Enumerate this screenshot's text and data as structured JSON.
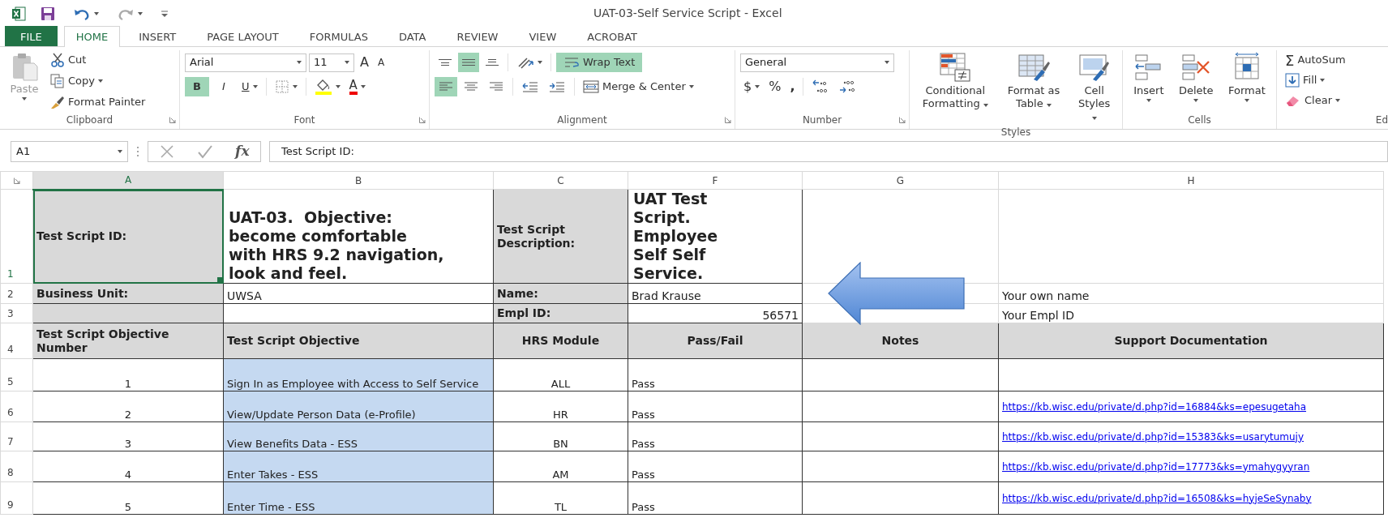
{
  "window": {
    "title": "UAT-03-Self Service Script - Excel"
  },
  "tabs": [
    {
      "label": "FILE",
      "kind": "file",
      "selected": false
    },
    {
      "label": "HOME",
      "kind": "tab",
      "selected": true
    },
    {
      "label": "INSERT",
      "kind": "tab",
      "selected": false
    },
    {
      "label": "PAGE LAYOUT",
      "kind": "tab",
      "selected": false
    },
    {
      "label": "FORMULAS",
      "kind": "tab",
      "selected": false
    },
    {
      "label": "DATA",
      "kind": "tab",
      "selected": false
    },
    {
      "label": "REVIEW",
      "kind": "tab",
      "selected": false
    },
    {
      "label": "VIEW",
      "kind": "tab",
      "selected": false
    },
    {
      "label": "ACROBAT",
      "kind": "tab",
      "selected": false
    }
  ],
  "ribbon": {
    "clipboard": {
      "label": "Clipboard",
      "paste": {
        "label": "Paste",
        "disabled": true
      },
      "cut": "Cut",
      "copy": "Copy",
      "format_painter": "Format Painter"
    },
    "font": {
      "label": "Font",
      "font_name": "Arial",
      "font_size": "11",
      "grow": "A",
      "shrink": "A",
      "bold": {
        "label": "B",
        "on": true
      },
      "italic": {
        "label": "I",
        "on": false
      },
      "underline": {
        "label": "U",
        "on": false
      },
      "font_color": "A"
    },
    "alignment": {
      "label": "Alignment",
      "vertical": [
        {
          "kind": "top",
          "selected": false
        },
        {
          "kind": "middle",
          "selected": true
        },
        {
          "kind": "bottom",
          "selected": false
        }
      ],
      "horizontal": [
        {
          "kind": "left",
          "selected": true
        },
        {
          "kind": "center",
          "selected": false
        },
        {
          "kind": "right",
          "selected": false
        }
      ],
      "wrap_text": {
        "label": "Wrap Text",
        "on": true
      },
      "merge": "Merge & Center"
    },
    "number": {
      "label": "Number",
      "format": "General",
      "currency": "$",
      "percent": "%",
      "comma": ","
    },
    "styles": {
      "label": "Styles",
      "buttons": [
        {
          "kind": "conditional",
          "label": "Conditional Formatting"
        },
        {
          "kind": "table",
          "label": "Format as Table"
        },
        {
          "kind": "cellstyles",
          "label": "Cell Styles"
        }
      ]
    },
    "cells": {
      "label": "Cells",
      "buttons": [
        {
          "kind": "insert",
          "label": "Insert"
        },
        {
          "kind": "delete",
          "label": "Delete"
        },
        {
          "kind": "format",
          "label": "Format"
        }
      ]
    },
    "editing": {
      "label": "Ed",
      "autosum": {
        "symbol": "Σ",
        "label": "AutoSum"
      },
      "fill": "Fill",
      "clear": "Clear"
    }
  },
  "formula_bar": {
    "name_box": "A1",
    "function_symbol": "fx",
    "formula": "Test Script ID:"
  },
  "sheet": {
    "columns": [
      {
        "label": "A",
        "selected": true
      },
      {
        "label": "B",
        "selected": false
      },
      {
        "label": "C",
        "selected": false
      },
      {
        "label": "F",
        "selected": false
      },
      {
        "label": "G",
        "selected": false
      },
      {
        "label": "H",
        "selected": false
      }
    ],
    "rows": [
      {
        "number": "1",
        "selected": true,
        "cells": [
          {
            "kind": "label",
            "text": "Test Script ID:",
            "selected": true
          },
          {
            "kind": "title",
            "text": "UAT-03.  Objective: become comfortable with HRS 9.2 navigation, look and feel.",
            "selected": false
          },
          {
            "kind": "label",
            "text": "Test Script Description:",
            "selected": false
          },
          {
            "kind": "title",
            "text": "UAT Test Script. Employee Self Self Service.",
            "selected": false
          },
          {
            "kind": "blank",
            "selected": false
          },
          {
            "kind": "blank",
            "selected": false
          }
        ]
      },
      {
        "number": "2",
        "selected": false,
        "cells": [
          {
            "kind": "label",
            "text": "Business Unit:",
            "selected": false
          },
          {
            "kind": "value",
            "text": "UWSA",
            "selected": false
          },
          {
            "kind": "label",
            "text": "Name:",
            "selected": false
          },
          {
            "kind": "value",
            "text": "Brad Krause",
            "selected": false
          },
          {
            "kind": "blank",
            "selected": false
          },
          {
            "kind": "hint",
            "text": "Your own name",
            "selected": false
          }
        ]
      },
      {
        "number": "3",
        "selected": false,
        "cells": [
          {
            "kind": "label",
            "selected": false
          },
          {
            "kind": "box",
            "selected": false
          },
          {
            "kind": "label",
            "text": "Empl ID:",
            "selected": false
          },
          {
            "kind": "number",
            "text": "56571",
            "selected": false
          },
          {
            "kind": "blank",
            "selected": false
          },
          {
            "kind": "hint",
            "text": "Your Empl ID",
            "selected": false
          }
        ]
      },
      {
        "number": "4",
        "selected": false,
        "cells": [
          {
            "kind": "caption",
            "text": "Test Script Objective Number",
            "selected": false
          },
          {
            "kind": "caption",
            "text": "Test Script Objective",
            "selected": false
          },
          {
            "kind": "header",
            "text": "HRS Module",
            "selected": false
          },
          {
            "kind": "header",
            "text": "Pass/Fail",
            "selected": false
          },
          {
            "kind": "header",
            "text": "Notes",
            "selected": false
          },
          {
            "kind": "header",
            "text": "Support Documentation",
            "selected": false
          }
        ]
      },
      {
        "number": "5",
        "selected": false,
        "cells": [
          {
            "kind": "index",
            "text": "1",
            "selected": false
          },
          {
            "kind": "objective",
            "text": "Sign In as Employee with Access to Self Service",
            "selected": false
          },
          {
            "kind": "index",
            "text": "ALL",
            "selected": false
          },
          {
            "kind": "status",
            "text": "Pass",
            "selected": false
          },
          {
            "kind": "box",
            "selected": false
          },
          {
            "kind": "box",
            "selected": false
          }
        ]
      },
      {
        "number": "6",
        "selected": false,
        "cells": [
          {
            "kind": "index",
            "text": "2",
            "selected": false
          },
          {
            "kind": "objective",
            "text": "View/Update Person Data (e-Profile)",
            "selected": false
          },
          {
            "kind": "index",
            "text": "HR",
            "selected": false
          },
          {
            "kind": "status",
            "text": "Pass",
            "selected": false
          },
          {
            "kind": "box",
            "selected": false
          },
          {
            "kind": "link",
            "text": "https://kb.wisc.edu/private/d.php?id=16884&ks=epesugetaha",
            "selected": false
          }
        ]
      },
      {
        "number": "7",
        "selected": false,
        "cells": [
          {
            "kind": "index",
            "text": "3",
            "selected": false
          },
          {
            "kind": "objective",
            "text": "View Benefits Data - ESS",
            "selected": false
          },
          {
            "kind": "index",
            "text": "BN",
            "selected": false
          },
          {
            "kind": "status",
            "text": "Pass",
            "selected": false
          },
          {
            "kind": "box",
            "selected": false
          },
          {
            "kind": "link",
            "text": "https://kb.wisc.edu/private/d.php?id=15383&ks=usarytumujy",
            "selected": false
          }
        ]
      },
      {
        "number": "8",
        "selected": false,
        "cells": [
          {
            "kind": "index",
            "text": "4",
            "selected": false
          },
          {
            "kind": "objective",
            "text": "Enter Takes - ESS",
            "selected": false
          },
          {
            "kind": "index",
            "text": "AM",
            "selected": false
          },
          {
            "kind": "status",
            "text": "Pass",
            "selected": false
          },
          {
            "kind": "box",
            "selected": false
          },
          {
            "kind": "link",
            "text": "https://kb.wisc.edu/private/d.php?id=17773&ks=ymahygyyran",
            "selected": false
          }
        ]
      },
      {
        "number": "9",
        "selected": false,
        "cells": [
          {
            "kind": "index",
            "text": "5",
            "selected": false
          },
          {
            "kind": "objective",
            "text": "Enter Time - ESS",
            "selected": false
          },
          {
            "kind": "index",
            "text": "TL",
            "selected": false
          },
          {
            "kind": "status",
            "text": "Pass",
            "selected": false
          },
          {
            "kind": "box",
            "selected": false
          },
          {
            "kind": "link",
            "text": "https://kb.wisc.edu/private/d.php?id=16508&ks=hyjeSeSynaby",
            "selected": false
          }
        ]
      }
    ]
  }
}
